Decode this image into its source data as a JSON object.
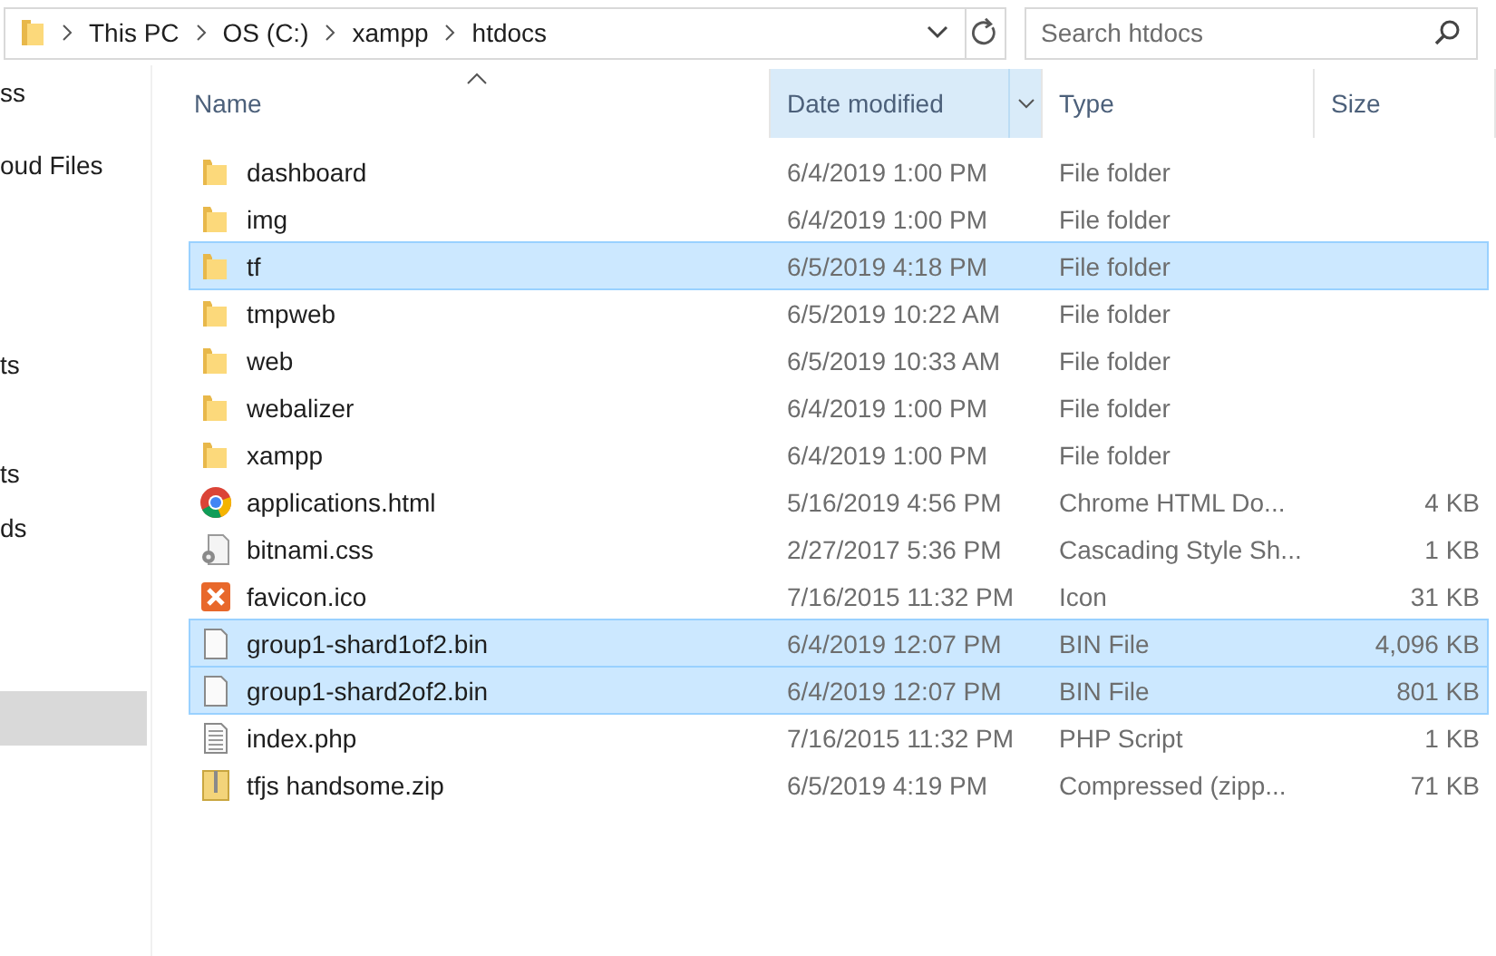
{
  "address_bar": {
    "crumbs": [
      "This PC",
      "OS (C:)",
      "xampp",
      "htdocs"
    ]
  },
  "search": {
    "placeholder": "Search htdocs"
  },
  "sidebar": {
    "items": [
      {
        "label": "ss",
        "selected": false
      },
      {
        "label": "oud Files",
        "selected": false
      },
      {
        "label": "ts",
        "selected": false
      },
      {
        "label": "ts",
        "selected": false
      },
      {
        "label": "ds",
        "selected": false
      },
      {
        "selected": true
      }
    ]
  },
  "columns": [
    {
      "label": "Name",
      "sorted": true,
      "active": false
    },
    {
      "label": "Date modified",
      "sorted": false,
      "active": true
    },
    {
      "label": "Type",
      "sorted": false,
      "active": false
    },
    {
      "label": "Size",
      "sorted": false,
      "active": false
    }
  ],
  "rows": [
    {
      "kind": "folder",
      "name": "dashboard",
      "date": "6/4/2019 1:00 PM",
      "type": "File folder",
      "selected": false
    },
    {
      "kind": "folder",
      "name": "img",
      "date": "6/4/2019 1:00 PM",
      "type": "File folder",
      "selected": false
    },
    {
      "kind": "folder",
      "name": "tf",
      "date": "6/5/2019 4:18 PM",
      "type": "File folder",
      "selected": true
    },
    {
      "kind": "folder",
      "name": "tmpweb",
      "date": "6/5/2019 10:22 AM",
      "type": "File folder",
      "selected": false
    },
    {
      "kind": "folder",
      "name": "web",
      "date": "6/5/2019 10:33 AM",
      "type": "File folder",
      "selected": false
    },
    {
      "kind": "folder",
      "name": "webalizer",
      "date": "6/4/2019 1:00 PM",
      "type": "File folder",
      "selected": false
    },
    {
      "kind": "folder",
      "name": "xampp",
      "date": "6/4/2019 1:00 PM",
      "type": "File folder",
      "selected": false
    },
    {
      "kind": "browser",
      "name": "applications.html",
      "date": "5/16/2019 4:56 PM",
      "type": "Chrome HTML Do...",
      "size": "4 KB",
      "selected": false
    },
    {
      "kind": "css",
      "name": "bitnami.css",
      "date": "2/27/2017 5:36 PM",
      "type": "Cascading Style Sh...",
      "size": "1 KB",
      "selected": false
    },
    {
      "kind": "app",
      "name": "favicon.ico",
      "date": "7/16/2015 11:32 PM",
      "type": "Icon",
      "size": "31 KB",
      "selected": false
    },
    {
      "kind": "blank",
      "name": "group1-shard1of2.bin",
      "date": "6/4/2019 12:07 PM",
      "type": "BIN File",
      "size": "4,096 KB",
      "selected": true
    },
    {
      "kind": "blank",
      "name": "group1-shard2of2.bin",
      "date": "6/4/2019 12:07 PM",
      "type": "BIN File",
      "size": "801 KB",
      "selected": true
    },
    {
      "kind": "text",
      "name": "index.php",
      "date": "7/16/2015 11:32 PM",
      "type": "PHP Script",
      "size": "1 KB",
      "selected": false
    },
    {
      "kind": "zip",
      "name": "tfjs handsome.zip",
      "date": "6/5/2019 4:19 PM",
      "type": "Compressed (zipp...",
      "size": "71 KB",
      "selected": false
    }
  ]
}
